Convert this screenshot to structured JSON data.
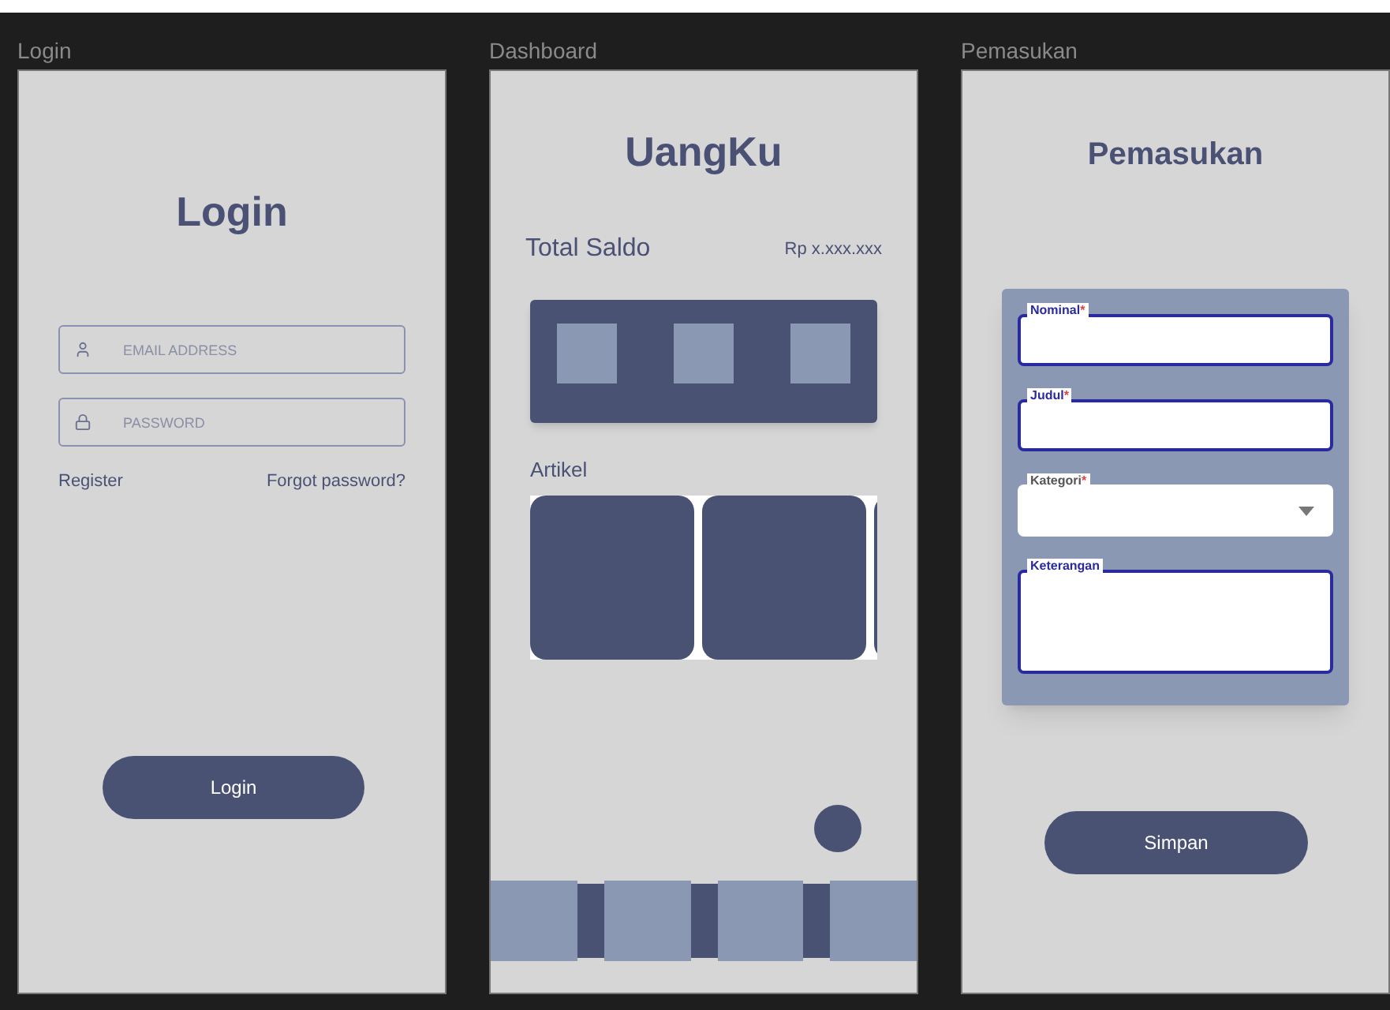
{
  "frames": [
    {
      "kind": "login",
      "label": "Login",
      "title": "Login",
      "fields": [
        {
          "placeholder": "EMAIL ADDRESS"
        },
        {
          "placeholder": "PASSWORD"
        }
      ],
      "links": [
        "Register",
        "Forgot password?"
      ],
      "button": "Login"
    },
    {
      "kind": "dashboard",
      "label": "Dashboard",
      "title": "UangKu",
      "balance_label": "Total Saldo",
      "balance_value": "Rp x.xxx.xxx",
      "section": "Artikel"
    },
    {
      "kind": "form",
      "label": "Pemasukan",
      "title": "Pemasukan",
      "fields": [
        {
          "kind": "text",
          "label": "Nominal",
          "mark": "*"
        },
        {
          "kind": "text",
          "label": "Judul",
          "mark": "*"
        },
        {
          "kind": "select",
          "label": "Kategori",
          "mark": "*"
        },
        {
          "kind": "textarea",
          "label": "Keterangan"
        }
      ],
      "button": "Simpan"
    }
  ]
}
